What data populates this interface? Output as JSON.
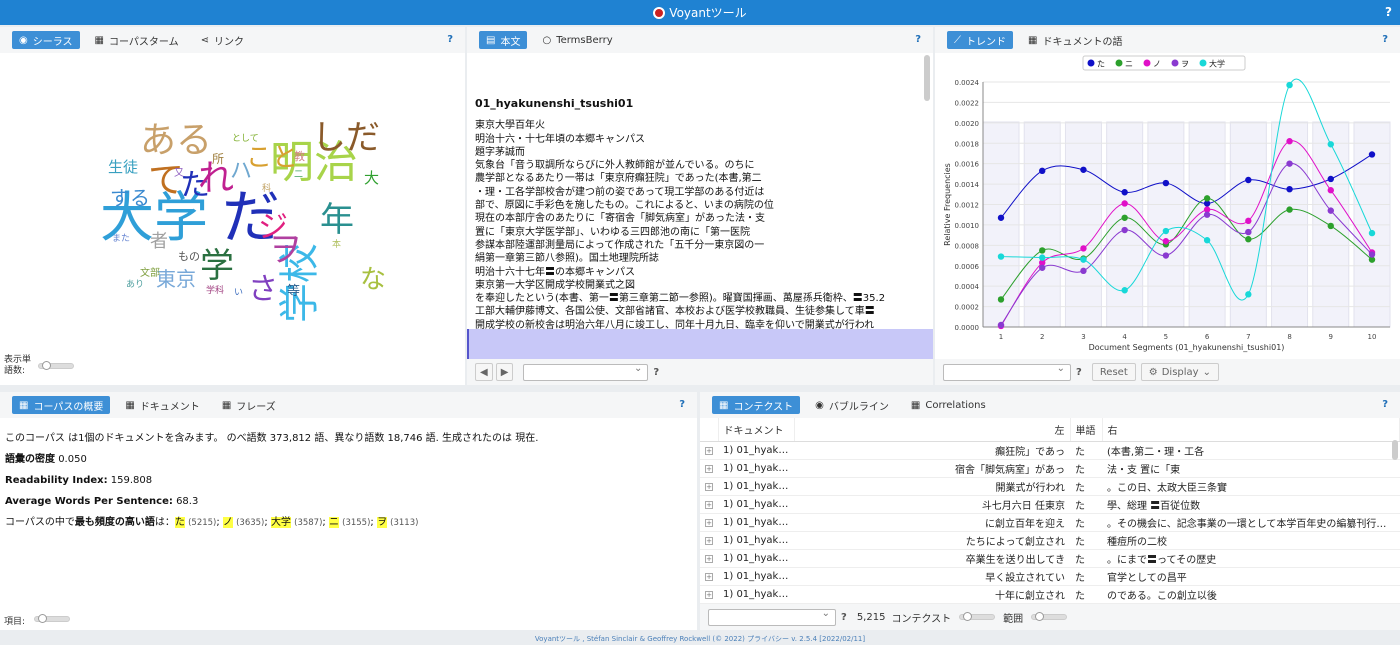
{
  "app": {
    "title": "Voyantツール",
    "help": "?"
  },
  "cloud_panel": {
    "tabs": [
      "シーラス",
      "コーパスターム",
      "リンク"
    ],
    "help": "?",
    "words": [
      {
        "t": "明治",
        "c": "#a8d44a"
      },
      {
        "t": "大学",
        "c": "#2f9fd8"
      },
      {
        "t": "ある",
        "c": "#c8a06a"
      },
      {
        "t": "年",
        "c": "#2a9090"
      },
      {
        "t": "学校",
        "c": "#3cb8e8"
      },
      {
        "t": "だ",
        "c": "#2030b8"
      },
      {
        "t": "た",
        "c": "#2030b8"
      },
      {
        "t": "しだ",
        "c": "#8a5a2a"
      },
      {
        "t": "て",
        "c": "#c07020"
      },
      {
        "t": "れ",
        "c": "#c02090"
      },
      {
        "t": "こと",
        "c": "#d8a030"
      },
      {
        "t": "する",
        "c": "#3a8ad0"
      },
      {
        "t": "生徒",
        "c": "#38a0c0"
      },
      {
        "t": "東京",
        "c": "#78a8d8"
      },
      {
        "t": "な",
        "c": "#a8c040"
      },
      {
        "t": "さ",
        "c": "#8040c0"
      },
      {
        "t": "学",
        "c": "#2a7040"
      },
      {
        "t": "ハ",
        "c": "#70a8d0"
      },
      {
        "t": "ジ",
        "c": "#e02080"
      },
      {
        "t": "大",
        "c": "#30a030"
      },
      {
        "t": "ヲ",
        "c": "#b040a0"
      },
      {
        "t": "等",
        "c": "#2a6090"
      },
      {
        "t": "もの",
        "c": "#555555"
      },
      {
        "t": "者",
        "c": "#a0a0a0"
      },
      {
        "t": "所",
        "c": "#a08040"
      },
      {
        "t": "文部",
        "c": "#80a040"
      },
      {
        "t": "学科",
        "c": "#a04080"
      },
      {
        "t": "として",
        "c": "#80b030"
      },
      {
        "t": "科",
        "c": "#c0a060"
      },
      {
        "t": "二",
        "c": "#40a060"
      },
      {
        "t": "い",
        "c": "#4070c0"
      },
      {
        "t": "あり",
        "c": "#50a0a0"
      },
      {
        "t": "教",
        "c": "#d08080"
      },
      {
        "t": "また",
        "c": "#6080d0"
      },
      {
        "t": "又",
        "c": "#9060c0"
      },
      {
        "t": "本",
        "c": "#b0c060"
      }
    ],
    "density_label": "表示単語数:"
  },
  "reader": {
    "tabs": [
      "本文",
      "TermsBerry"
    ],
    "help": "?",
    "doc_title": "01_hyakunenshi_tsushi01",
    "lines": [
      "東京大學百年火",
      "明治十六・十七年頃の本郷キャンパス",
      "題字茅誠而",
      "気象台「音う取調所ならびに外人教師館が並んでいる。のちに",
      "農学部となるあたり一帯は「東京府癲狂院」であった(本書,第二",
      "・理・工各学部校舎が建つ前の姿であって現工学部のある付近は",
      "部で、原図に手彩色を施したもの。これによると、いまの病院の位",
      "現在の本部庁舎のあたりに「寄宿舎「脚気病室」があった法・支",
      "置に「東京大学医学部」、いわゆる三四郎池の南に「第一医院",
      "参謀本部陸運部測量局によって作成された「五千分一東京図の一",
      "絹第一章第三節八参照)。国土地理院所誌",
      "明治十六十七年〓の本郷キャンパス",
      "東京第一大学区開成学校開業式之図",
      "を奉迎したという(本書、第一〓第三章第二節一参照)。曜寶国揮画、萬屋孫兵衛枠、〓35.2",
      "工部大輔伊藤博文、各国公使、文部省諸官、本校および医学校教職員、生徒参集して車〓",
      "開成学校の新校舎は明治六年八月に竣工し、同年十月九日、臨幸を仰いで開業式が行われ",
      "た。この日、太政大臣三条實美、参議後藤象次郎、同板垣退助、同大木喬任,岡江藤新平"
    ],
    "help2": "?"
  },
  "trend": {
    "tabs": [
      "トレンド",
      "ドキュメントの語"
    ],
    "help": "?",
    "legend": [
      {
        "name": "た",
        "color": "#1010c8"
      },
      {
        "name": "ニ",
        "color": "#2ca02c"
      },
      {
        "name": "ノ",
        "color": "#e010c8"
      },
      {
        "name": "ヲ",
        "color": "#8a3ad0"
      },
      {
        "name": "大学",
        "color": "#18d8d8"
      }
    ],
    "ylabel": "Relative Frequencies",
    "xlabel": "Document Segments (01_hyakunenshi_tsushi01)",
    "reset": "Reset",
    "display": "Display",
    "help2": "?"
  },
  "chart_data": {
    "type": "line",
    "title": "",
    "xlabel": "Document Segments (01_hyakunenshi_tsushi01)",
    "ylabel": "Relative Frequencies",
    "x": [
      1,
      2,
      3,
      4,
      5,
      6,
      7,
      8,
      9,
      10
    ],
    "ylim": [
      0,
      0.0024
    ],
    "yticks": [
      "0.0000",
      "0.0002",
      "0.0004",
      "0.0006",
      "0.0008",
      "0.0010",
      "0.0012",
      "0.0014",
      "0.0016",
      "0.0018",
      "0.0020",
      "0.0022",
      "0.0024"
    ],
    "series": [
      {
        "name": "た",
        "color": "#1010c8",
        "values": [
          0.00107,
          0.00153,
          0.00154,
          0.00132,
          0.00141,
          0.00121,
          0.00144,
          0.00135,
          0.00145,
          0.00169
        ]
      },
      {
        "name": "ニ",
        "color": "#2ca02c",
        "values": [
          0.00027,
          0.00075,
          0.00067,
          0.00107,
          0.00081,
          0.00126,
          0.00086,
          0.00115,
          0.00099,
          0.00066
        ]
      },
      {
        "name": "ノ",
        "color": "#e010c8",
        "values": [
          1e-05,
          0.00063,
          0.00077,
          0.00121,
          0.00084,
          0.00115,
          0.00104,
          0.00182,
          0.00134,
          0.00073
        ]
      },
      {
        "name": "ヲ",
        "color": "#8a3ad0",
        "values": [
          2e-05,
          0.00058,
          0.00055,
          0.00095,
          0.0007,
          0.0011,
          0.00093,
          0.0016,
          0.00114,
          0.00071
        ]
      },
      {
        "name": "大学",
        "color": "#18d8d8",
        "values": [
          0.00069,
          0.00068,
          0.00066,
          0.00036,
          0.00094,
          0.00085,
          0.00032,
          0.00237,
          0.00179,
          0.00092
        ]
      }
    ],
    "grid": true,
    "legend_position": "top"
  },
  "summary": {
    "tabs": [
      "コーパスの概要",
      "ドキュメント",
      "フレーズ"
    ],
    "help": "?",
    "line1": "このコーパス は1個のドキュメントを含みます。 のべ語数 373,812 語、異なり語数 18,746 語. 生成されたのは 現在.",
    "density_label": "語彙の密度",
    "density_value": "0.050",
    "readability_label": "Readability Index:",
    "readability_value": "159.808",
    "awps_label": "Average Words Per Sentence:",
    "awps_value": "68.3",
    "freq_pre": "コーパスの中で",
    "freq_bold": "最も頻度の高い語",
    "freq_post": "は：",
    "freq_terms": [
      {
        "t": "た",
        "n": "(5215)"
      },
      {
        "t": "ノ",
        "n": "(3635)"
      },
      {
        "t": "大学",
        "n": "(3587)"
      },
      {
        "t": "ニ",
        "n": "(3155)"
      },
      {
        "t": "ヲ",
        "n": "(3113)"
      }
    ],
    "items_label": "項目:"
  },
  "context": {
    "tabs": [
      "コンテクスト",
      "バブルライン",
      "Correlations"
    ],
    "help": "?",
    "headers": [
      "ドキュメント",
      "左",
      "単語",
      "右"
    ],
    "rows": [
      {
        "doc": "1) 01_hyak…",
        "left": "癲狂院」であっ",
        "word": "た",
        "right": "(本書,第二・理・工各"
      },
      {
        "doc": "1) 01_hyak…",
        "left": "宿舎「脚気病室」があっ",
        "word": "た",
        "right": "法・支 置に「東"
      },
      {
        "doc": "1) 01_hyak…",
        "left": "開業式が行われ",
        "word": "た",
        "right": "。この日、太政大臣三条實"
      },
      {
        "doc": "1) 01_hyak…",
        "left": "斗七月六日 任東京",
        "word": "た",
        "right": "學、総理 〓百従位数"
      },
      {
        "doc": "1) 01_hyak…",
        "left": "に創立百年を迎え",
        "word": "た",
        "right": "。その機会に、記念事業の一環として本学百年史の編纂刊行…"
      },
      {
        "doc": "1) 01_hyak…",
        "left": "たちによって創立され",
        "word": "た",
        "right": "種痘所の二校"
      },
      {
        "doc": "1) 01_hyak…",
        "left": "卒業生を送り出してき",
        "word": "た",
        "right": "。にまで〓ってその歴史"
      },
      {
        "doc": "1) 01_hyak…",
        "left": "早く設立されてい",
        "word": "た",
        "right": "官学としての昌平"
      },
      {
        "doc": "1) 01_hyak…",
        "left": "十年に創立され",
        "word": "た",
        "right": "のである。この創立以後"
      }
    ],
    "count": "5,215",
    "context_label": "コンテクスト",
    "range_label": "範囲",
    "help2": "?"
  },
  "footer": "Voyantツール , Stéfan Sinclair & Geoffrey Rockwell (© 2022) プライバシー v. 2.5.4 [2022/02/11]"
}
